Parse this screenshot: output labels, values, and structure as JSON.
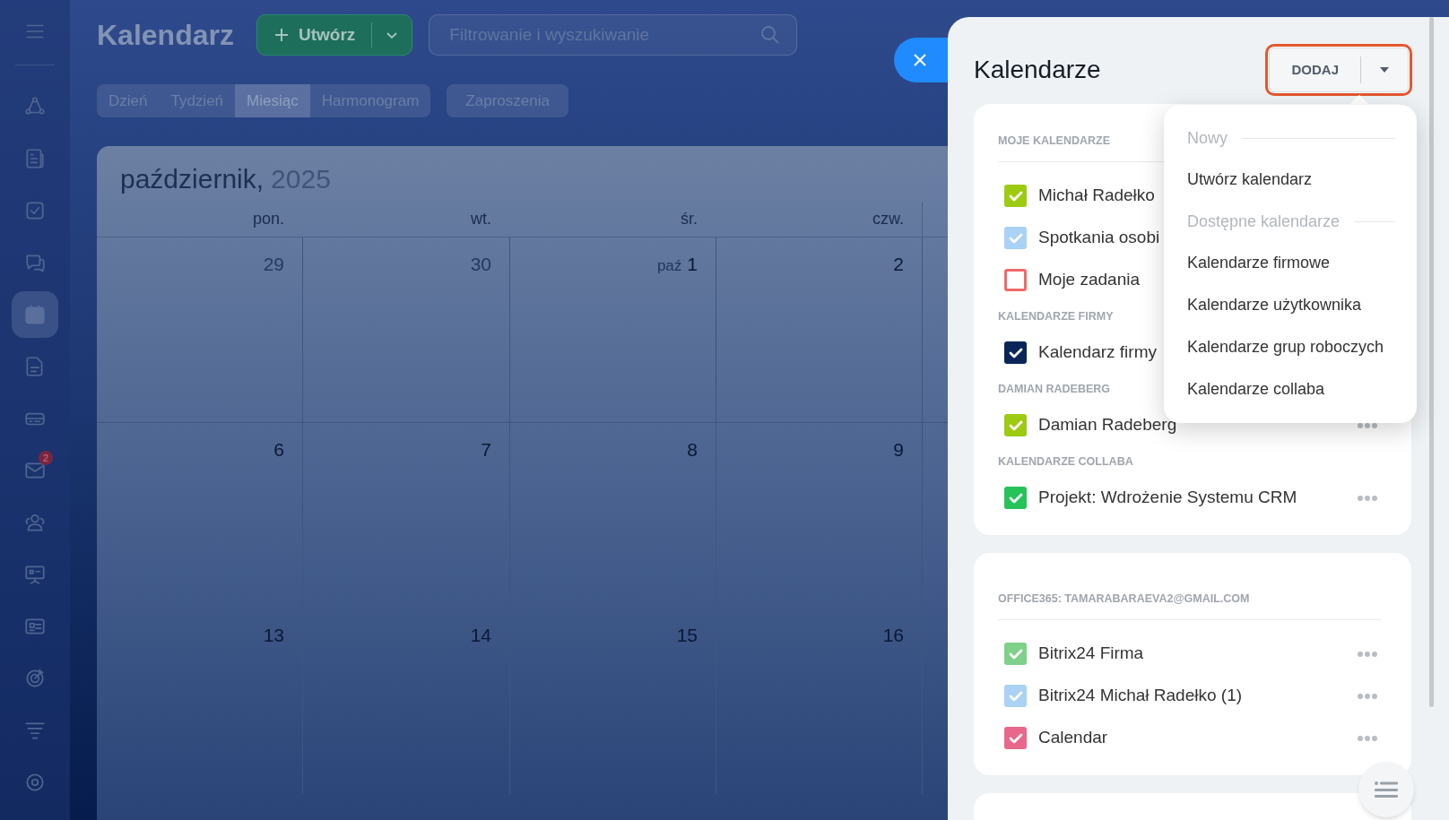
{
  "sidebar": {
    "menu_button": true,
    "items": [
      {
        "kind": "share",
        "selected": false
      },
      {
        "kind": "news",
        "selected": false
      },
      {
        "kind": "task",
        "selected": false
      },
      {
        "kind": "chat",
        "selected": false
      },
      {
        "kind": "calendar",
        "selected": true
      },
      {
        "kind": "document",
        "selected": false
      },
      {
        "kind": "drive",
        "selected": false
      },
      {
        "kind": "mail",
        "selected": false,
        "badge": "2"
      },
      {
        "kind": "contacts",
        "selected": false
      },
      {
        "kind": "board",
        "selected": false
      },
      {
        "kind": "card",
        "selected": false
      },
      {
        "kind": "target",
        "selected": false
      },
      {
        "kind": "funnel",
        "selected": false
      },
      {
        "kind": "settings",
        "selected": false
      }
    ]
  },
  "header": {
    "title": "Kalendarz",
    "create_button": "Utwórz",
    "search": {
      "placeholder": "Filtrowanie i wyszukiwanie"
    }
  },
  "view_tabs": [
    {
      "label": "Dzień",
      "selected": false
    },
    {
      "label": "Tydzień",
      "selected": false
    },
    {
      "label": "Miesiąc",
      "selected": true
    },
    {
      "label": "Harmonogram",
      "selected": false
    }
  ],
  "invitations_button": "Zaproszenia",
  "calendar": {
    "month": "październik,",
    "year": "2025",
    "weekdays": [
      "pon.",
      "wt.",
      "śr.",
      "czw."
    ],
    "weeks": [
      [
        {
          "day": "29",
          "other_month": true
        },
        {
          "day": "30",
          "other_month": true
        },
        {
          "day": "1",
          "month_label": "paź",
          "other_month": false
        },
        {
          "day": "2",
          "other_month": false
        }
      ],
      [
        {
          "day": "6",
          "other_month": false
        },
        {
          "day": "7",
          "other_month": false
        },
        {
          "day": "8",
          "other_month": false
        },
        {
          "day": "9",
          "other_month": false
        }
      ],
      [
        {
          "day": "13",
          "other_month": false
        },
        {
          "day": "14",
          "other_month": false
        },
        {
          "day": "15",
          "other_month": false
        },
        {
          "day": "16",
          "other_month": false
        }
      ]
    ]
  },
  "panel": {
    "title": "Kalendarze",
    "add_button": "DODAJ",
    "cards": [
      {
        "sections": [
          {
            "heading": "MOJE KALENDARZE",
            "items": [
              {
                "label": "Michał Radełko",
                "color": "#9dcb14",
                "checked": true
              },
              {
                "label": "Spotkania osobi",
                "color": "#a9d2f5",
                "checked": true
              },
              {
                "label": "Moje zadania",
                "color": "#ef6a6a",
                "checked": false
              }
            ]
          },
          {
            "heading": "KALENDARZE FIRMY",
            "items": [
              {
                "label": "Kalendarz firmy",
                "color": "#0b2559",
                "checked": true
              }
            ]
          },
          {
            "heading": "DAMIAN RADEBERG",
            "items": [
              {
                "label": "Damian Radeberg",
                "color": "#9dcb14",
                "checked": true,
                "menu": true
              }
            ]
          },
          {
            "heading": "KALENDARZE COLLABA",
            "items": [
              {
                "label": "Projekt: Wdrożenie Systemu CRM",
                "color": "#26c25a",
                "checked": true,
                "menu": true
              }
            ]
          }
        ]
      },
      {
        "sections": [
          {
            "heading": "OFFICE365: TAMARABARAEVA2@GMAIL.COM",
            "items": [
              {
                "label": "Bitrix24 Firma",
                "color": "#7fd08a",
                "checked": true,
                "menu": true
              },
              {
                "label": "Bitrix24 Michał Radełko (1)",
                "color": "#a9d2f5",
                "checked": true,
                "menu": true
              },
              {
                "label": "Calendar",
                "color": "#e8678b",
                "checked": true,
                "menu": true
              }
            ]
          }
        ]
      }
    ]
  },
  "add_menu": [
    {
      "kind": "heading",
      "label": "Nowy"
    },
    {
      "kind": "item",
      "label": "Utwórz kalendarz"
    },
    {
      "kind": "heading",
      "label": "Dostępne kalendarze"
    },
    {
      "kind": "item",
      "label": "Kalendarze firmowe"
    },
    {
      "kind": "item",
      "label": "Kalendarze użytkownika"
    },
    {
      "kind": "item",
      "label": "Kalendarze grup roboczych"
    },
    {
      "kind": "item",
      "label": "Kalendarze collaba"
    }
  ]
}
